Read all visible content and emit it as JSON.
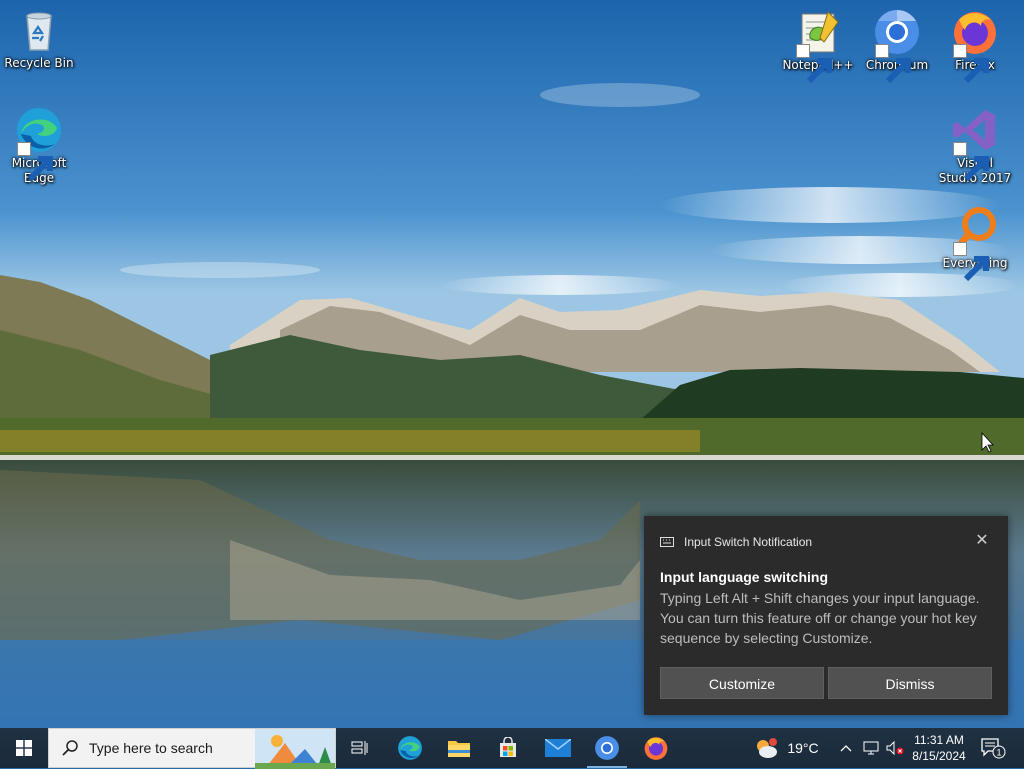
{
  "desktop": {
    "icons": [
      {
        "label": "Recycle Bin",
        "icon": "recycle-bin-icon"
      },
      {
        "label": "Microsoft Edge",
        "icon": "edge-icon"
      },
      {
        "label": "Notepad++",
        "icon": "notepadpp-icon"
      },
      {
        "label": "Chromium",
        "icon": "chromium-icon"
      },
      {
        "label": "Firefox",
        "icon": "firefox-icon"
      },
      {
        "label": "Visual Studio 2017",
        "icon": "visual-studio-icon"
      },
      {
        "label": "Everything",
        "icon": "everything-icon"
      }
    ]
  },
  "notification": {
    "app_name": "Input Switch Notification",
    "title": "Input language switching",
    "body": "Typing Left Alt + Shift changes your input language. You can turn this feature off or change your hot key sequence by selecting Customize.",
    "close_glyph": "✕",
    "buttons": {
      "customize": "Customize",
      "dismiss": "Dismiss"
    }
  },
  "taskbar": {
    "search_placeholder": "Type here to search",
    "pinned": [
      "task-view",
      "edge",
      "file-explorer",
      "microsoft-store",
      "mail",
      "chromium",
      "firefox"
    ],
    "weather": {
      "temperature": "19°C"
    },
    "clock": {
      "time": "11:31 AM",
      "date": "8/15/2024"
    },
    "notification_count": "1"
  },
  "colors": {
    "toast_bg": "#2b2b2b",
    "toast_button": "#515151",
    "taskbar_bg": "#1c2c3c",
    "accent": "#0078d7"
  }
}
